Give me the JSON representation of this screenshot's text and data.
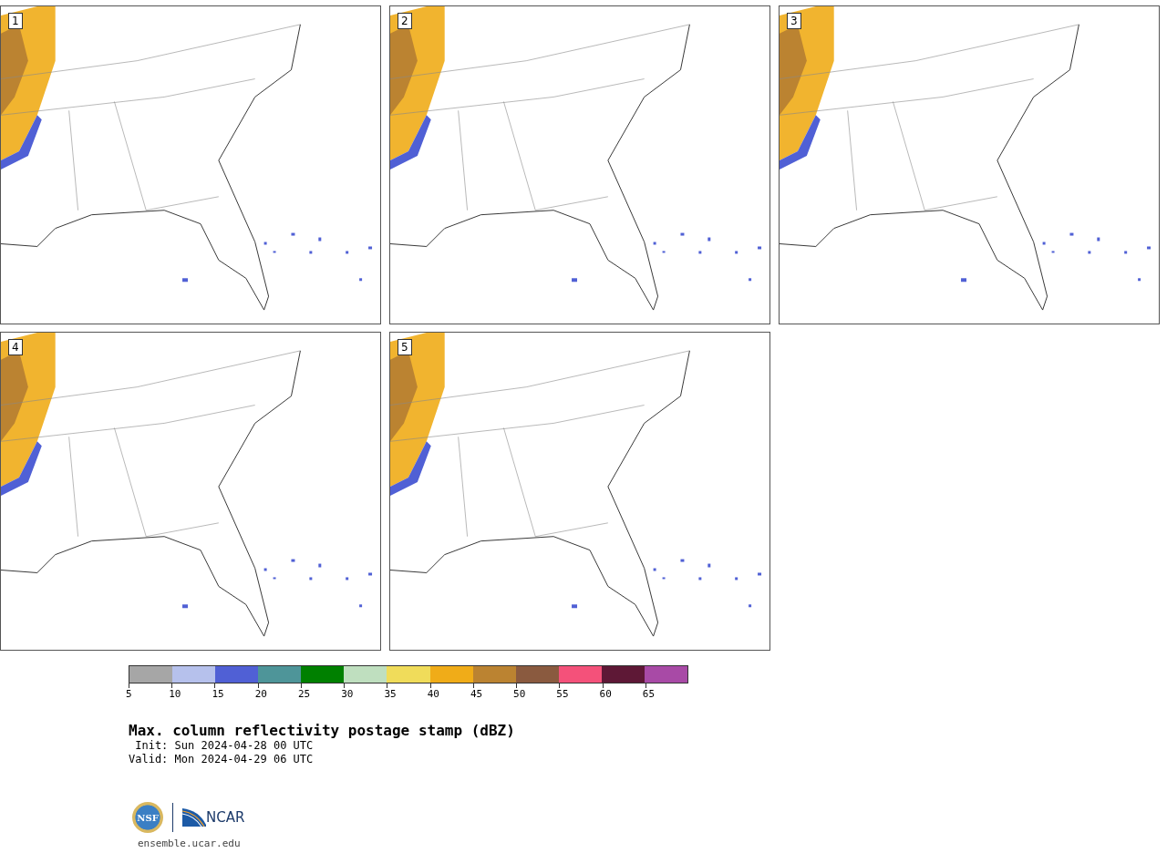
{
  "panels": [
    {
      "label": "1"
    },
    {
      "label": "2"
    },
    {
      "label": "3"
    },
    {
      "label": "4"
    },
    {
      "label": "5"
    }
  ],
  "colorbar": {
    "bins": [
      {
        "label": "5",
        "color": "#a6a6a6"
      },
      {
        "label": "10",
        "color": "#b6c1ec"
      },
      {
        "label": "15",
        "color": "#5060d5"
      },
      {
        "label": "20",
        "color": "#4e9599"
      },
      {
        "label": "25",
        "color": "#008000"
      },
      {
        "label": "30",
        "color": "#bfdfbf"
      },
      {
        "label": "35",
        "color": "#f0dc5a"
      },
      {
        "label": "40",
        "color": "#f0ac18"
      },
      {
        "label": "45",
        "color": "#bb8331"
      },
      {
        "label": "50",
        "color": "#8a5a3f"
      },
      {
        "label": "55",
        "color": "#f4517a"
      },
      {
        "label": "60",
        "color": "#5e1836"
      },
      {
        "label": "65",
        "color": "#a84aa6"
      }
    ]
  },
  "title": "Max. column reflectivity postage stamp (dBZ)",
  "init": " Init: Sun 2024-04-28 00 UTC",
  "valid": "Valid: Mon 2024-04-29 06 UTC",
  "logos": {
    "nsf": "NSF",
    "ncar": "NCAR"
  },
  "footer_link": "ensemble.ucar.edu"
}
